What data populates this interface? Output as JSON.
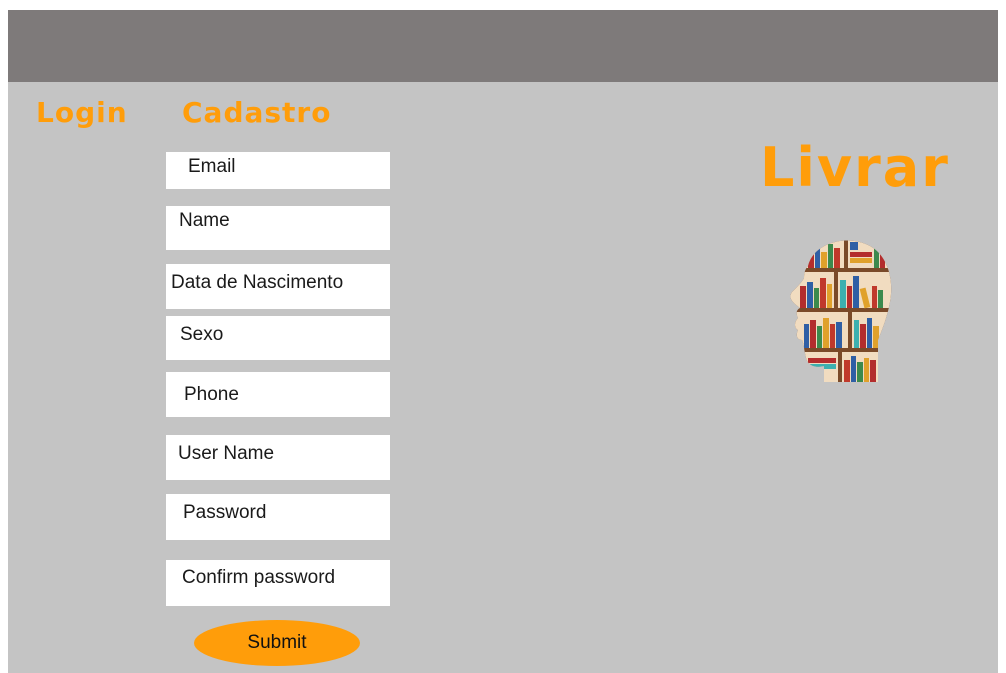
{
  "nav": {
    "login_label": "Login",
    "cadastro_label": "Cadastro"
  },
  "form": {
    "fields": [
      {
        "label": "Email"
      },
      {
        "label": "Name"
      },
      {
        "label": "Data de Nascimento"
      },
      {
        "label": "Sexo"
      },
      {
        "label": "Phone"
      },
      {
        "label": "User Name"
      },
      {
        "label": "Password"
      },
      {
        "label": "Confirm password"
      }
    ],
    "submit_label": "Submit"
  },
  "brand": {
    "title": "Livrar",
    "logo_icon": "head-bookshelf-icon"
  },
  "colors": {
    "accent": "#ff9d0a",
    "topbar": "#7e7a7a",
    "background": "#c4c4c4",
    "field": "#ffffff"
  }
}
